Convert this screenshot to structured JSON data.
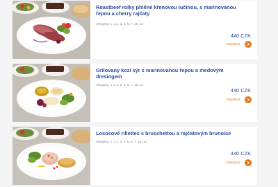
{
  "menu": {
    "items": [
      {
        "title": "Roastbeef rolky plněné křenovou lučinou, s marinovanou řepou a cherry rajčaty",
        "allergens": "Alergeny: 1, 1.1, 3, 5, 6, 7, 10, 12",
        "price": "440 CZK",
        "order_label": "Objednat",
        "icon": "arrow-right-icon"
      },
      {
        "title": "Grilovaný kozí sýr s marinovanou řepou a medovým dresingem",
        "allergens": "Alergeny: 1, 1.1, 3, 5, 6, 7, 10, 12",
        "price": "440 CZK",
        "order_label": "Objednat",
        "icon": "arrow-right-icon"
      },
      {
        "title": "Lososové rillettes s bruschettou a rajčatovým brunoise",
        "allergens": "Alergeny: 1, 1.1, 3, 4, 5, 6, 7, 10, 12",
        "price": "440 CZK",
        "order_label": "Objednat",
        "icon": "arrow-right-icon"
      }
    ]
  },
  "colors": {
    "title": "#2b4a9a",
    "price": "#2b4a9a",
    "accent": "#e8751a",
    "allergens": "#7a7f8a",
    "page_background": "#f4f4f5"
  }
}
